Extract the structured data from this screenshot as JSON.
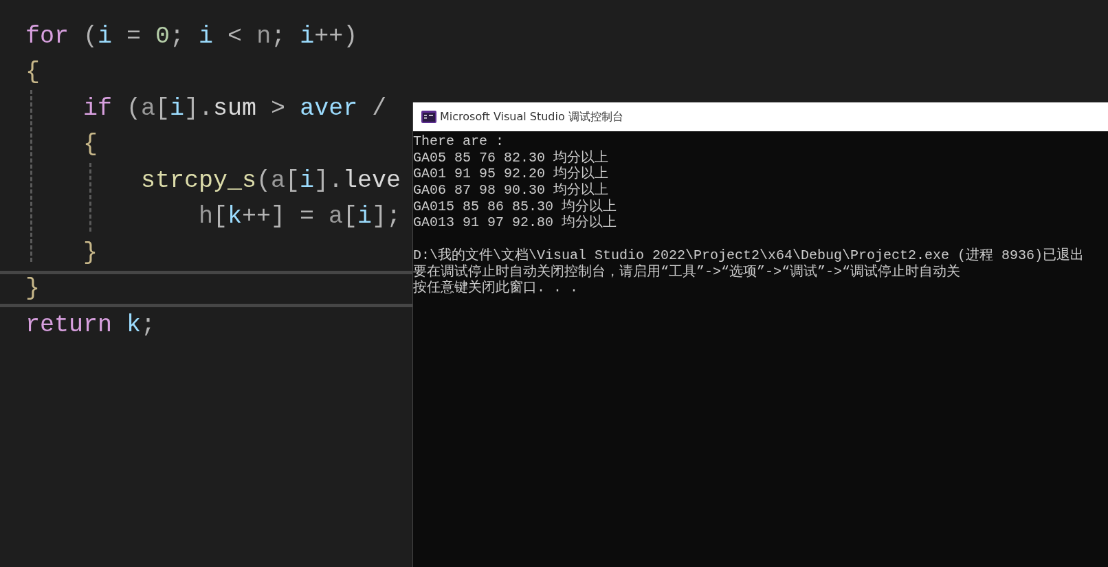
{
  "editor": {
    "lines": [
      {
        "current": false,
        "tokens": [
          {
            "kind": "keyword",
            "text": "for"
          },
          {
            "kind": "punct",
            "text": " ("
          },
          {
            "kind": "local",
            "text": "i"
          },
          {
            "kind": "punct",
            "text": " = "
          },
          {
            "kind": "number",
            "text": "0"
          },
          {
            "kind": "punct",
            "text": "; "
          },
          {
            "kind": "local",
            "text": "i"
          },
          {
            "kind": "punct",
            "text": " < "
          },
          {
            "kind": "param",
            "text": "n"
          },
          {
            "kind": "punct",
            "text": "; "
          },
          {
            "kind": "local",
            "text": "i"
          },
          {
            "kind": "punct",
            "text": "++)"
          }
        ]
      },
      {
        "current": false,
        "tokens": [
          {
            "kind": "brace",
            "text": "{"
          }
        ],
        "children": [
          {
            "current": false,
            "tokens": [
              {
                "kind": "keyword",
                "text": "if"
              },
              {
                "kind": "punct",
                "text": " ("
              },
              {
                "kind": "param",
                "text": "a"
              },
              {
                "kind": "punct",
                "text": "["
              },
              {
                "kind": "local",
                "text": "i"
              },
              {
                "kind": "punct",
                "text": "]."
              },
              {
                "kind": "member",
                "text": "sum"
              },
              {
                "kind": "punct",
                "text": " > "
              },
              {
                "kind": "local",
                "text": "aver"
              },
              {
                "kind": "punct",
                "text": " /"
              }
            ]
          },
          {
            "current": false,
            "tokens": [
              {
                "kind": "brace",
                "text": "{"
              }
            ],
            "children": [
              {
                "current": false,
                "tokens": [
                  {
                    "kind": "func",
                    "text": "strcpy_s"
                  },
                  {
                    "kind": "punct",
                    "text": "("
                  },
                  {
                    "kind": "param",
                    "text": "a"
                  },
                  {
                    "kind": "punct",
                    "text": "["
                  },
                  {
                    "kind": "local",
                    "text": "i"
                  },
                  {
                    "kind": "punct",
                    "text": "]."
                  },
                  {
                    "kind": "member",
                    "text": "leve"
                  }
                ],
                "children": [
                  {
                    "current": false,
                    "tokens": [
                      {
                        "kind": "param",
                        "text": "h"
                      },
                      {
                        "kind": "punct",
                        "text": "["
                      },
                      {
                        "kind": "local",
                        "text": "k"
                      },
                      {
                        "kind": "punct",
                        "text": "++] = "
                      },
                      {
                        "kind": "param",
                        "text": "a"
                      },
                      {
                        "kind": "punct",
                        "text": "["
                      },
                      {
                        "kind": "local",
                        "text": "i"
                      },
                      {
                        "kind": "punct",
                        "text": "];"
                      }
                    ]
                  }
                ]
              }
            ]
          },
          {
            "current": false,
            "tokens": [
              {
                "kind": "brace",
                "text": "}"
              }
            ]
          }
        ]
      },
      {
        "current": true,
        "tokens": [
          {
            "kind": "brace",
            "text": "}"
          }
        ]
      },
      {
        "current": false,
        "tokens": [
          {
            "kind": "keyword",
            "text": "return"
          },
          {
            "kind": "local",
            "text": " k"
          },
          {
            "kind": "punct",
            "text": ";"
          }
        ]
      }
    ]
  },
  "console": {
    "title": "Microsoft Visual Studio 调试控制台",
    "output": [
      "There are :",
      "GA05 85 76 82.30 均分以上",
      "GA01 91 95 92.20 均分以上",
      "GA06 87 98 90.30 均分以上",
      "GA015 85 86 85.30 均分以上",
      "GA013 91 97 92.80 均分以上"
    ],
    "exit_messages": [
      "D:\\我的文件\\文档\\Visual Studio 2022\\Project2\\x64\\Debug\\Project2.exe (进程 8936)已退出",
      "要在调试停止时自动关闭控制台，请启用“工具”->“选项”->“调试”->“调试停止时自动关",
      "按任意键关闭此窗口. . ."
    ]
  }
}
